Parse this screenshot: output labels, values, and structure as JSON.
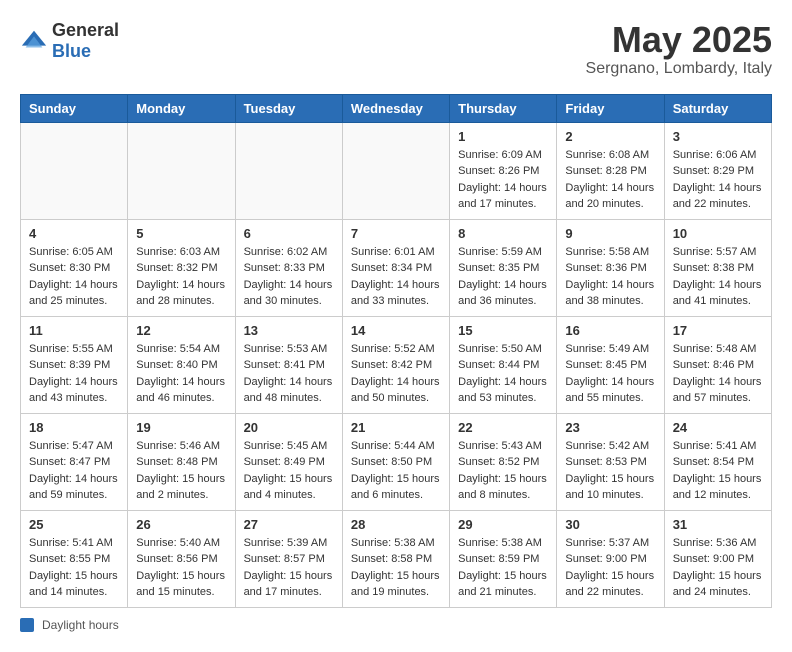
{
  "header": {
    "logo_general": "General",
    "logo_blue": "Blue",
    "title": "May 2025",
    "location": "Sergnano, Lombardy, Italy"
  },
  "weekdays": [
    "Sunday",
    "Monday",
    "Tuesday",
    "Wednesday",
    "Thursday",
    "Friday",
    "Saturday"
  ],
  "weeks": [
    [
      {
        "day": "",
        "info": ""
      },
      {
        "day": "",
        "info": ""
      },
      {
        "day": "",
        "info": ""
      },
      {
        "day": "",
        "info": ""
      },
      {
        "day": "1",
        "info": "Sunrise: 6:09 AM\nSunset: 8:26 PM\nDaylight: 14 hours\nand 17 minutes."
      },
      {
        "day": "2",
        "info": "Sunrise: 6:08 AM\nSunset: 8:28 PM\nDaylight: 14 hours\nand 20 minutes."
      },
      {
        "day": "3",
        "info": "Sunrise: 6:06 AM\nSunset: 8:29 PM\nDaylight: 14 hours\nand 22 minutes."
      }
    ],
    [
      {
        "day": "4",
        "info": "Sunrise: 6:05 AM\nSunset: 8:30 PM\nDaylight: 14 hours\nand 25 minutes."
      },
      {
        "day": "5",
        "info": "Sunrise: 6:03 AM\nSunset: 8:32 PM\nDaylight: 14 hours\nand 28 minutes."
      },
      {
        "day": "6",
        "info": "Sunrise: 6:02 AM\nSunset: 8:33 PM\nDaylight: 14 hours\nand 30 minutes."
      },
      {
        "day": "7",
        "info": "Sunrise: 6:01 AM\nSunset: 8:34 PM\nDaylight: 14 hours\nand 33 minutes."
      },
      {
        "day": "8",
        "info": "Sunrise: 5:59 AM\nSunset: 8:35 PM\nDaylight: 14 hours\nand 36 minutes."
      },
      {
        "day": "9",
        "info": "Sunrise: 5:58 AM\nSunset: 8:36 PM\nDaylight: 14 hours\nand 38 minutes."
      },
      {
        "day": "10",
        "info": "Sunrise: 5:57 AM\nSunset: 8:38 PM\nDaylight: 14 hours\nand 41 minutes."
      }
    ],
    [
      {
        "day": "11",
        "info": "Sunrise: 5:55 AM\nSunset: 8:39 PM\nDaylight: 14 hours\nand 43 minutes."
      },
      {
        "day": "12",
        "info": "Sunrise: 5:54 AM\nSunset: 8:40 PM\nDaylight: 14 hours\nand 46 minutes."
      },
      {
        "day": "13",
        "info": "Sunrise: 5:53 AM\nSunset: 8:41 PM\nDaylight: 14 hours\nand 48 minutes."
      },
      {
        "day": "14",
        "info": "Sunrise: 5:52 AM\nSunset: 8:42 PM\nDaylight: 14 hours\nand 50 minutes."
      },
      {
        "day": "15",
        "info": "Sunrise: 5:50 AM\nSunset: 8:44 PM\nDaylight: 14 hours\nand 53 minutes."
      },
      {
        "day": "16",
        "info": "Sunrise: 5:49 AM\nSunset: 8:45 PM\nDaylight: 14 hours\nand 55 minutes."
      },
      {
        "day": "17",
        "info": "Sunrise: 5:48 AM\nSunset: 8:46 PM\nDaylight: 14 hours\nand 57 minutes."
      }
    ],
    [
      {
        "day": "18",
        "info": "Sunrise: 5:47 AM\nSunset: 8:47 PM\nDaylight: 14 hours\nand 59 minutes."
      },
      {
        "day": "19",
        "info": "Sunrise: 5:46 AM\nSunset: 8:48 PM\nDaylight: 15 hours\nand 2 minutes."
      },
      {
        "day": "20",
        "info": "Sunrise: 5:45 AM\nSunset: 8:49 PM\nDaylight: 15 hours\nand 4 minutes."
      },
      {
        "day": "21",
        "info": "Sunrise: 5:44 AM\nSunset: 8:50 PM\nDaylight: 15 hours\nand 6 minutes."
      },
      {
        "day": "22",
        "info": "Sunrise: 5:43 AM\nSunset: 8:52 PM\nDaylight: 15 hours\nand 8 minutes."
      },
      {
        "day": "23",
        "info": "Sunrise: 5:42 AM\nSunset: 8:53 PM\nDaylight: 15 hours\nand 10 minutes."
      },
      {
        "day": "24",
        "info": "Sunrise: 5:41 AM\nSunset: 8:54 PM\nDaylight: 15 hours\nand 12 minutes."
      }
    ],
    [
      {
        "day": "25",
        "info": "Sunrise: 5:41 AM\nSunset: 8:55 PM\nDaylight: 15 hours\nand 14 minutes."
      },
      {
        "day": "26",
        "info": "Sunrise: 5:40 AM\nSunset: 8:56 PM\nDaylight: 15 hours\nand 15 minutes."
      },
      {
        "day": "27",
        "info": "Sunrise: 5:39 AM\nSunset: 8:57 PM\nDaylight: 15 hours\nand 17 minutes."
      },
      {
        "day": "28",
        "info": "Sunrise: 5:38 AM\nSunset: 8:58 PM\nDaylight: 15 hours\nand 19 minutes."
      },
      {
        "day": "29",
        "info": "Sunrise: 5:38 AM\nSunset: 8:59 PM\nDaylight: 15 hours\nand 21 minutes."
      },
      {
        "day": "30",
        "info": "Sunrise: 5:37 AM\nSunset: 9:00 PM\nDaylight: 15 hours\nand 22 minutes."
      },
      {
        "day": "31",
        "info": "Sunrise: 5:36 AM\nSunset: 9:00 PM\nDaylight: 15 hours\nand 24 minutes."
      }
    ]
  ],
  "footer": {
    "label": "Daylight hours"
  }
}
